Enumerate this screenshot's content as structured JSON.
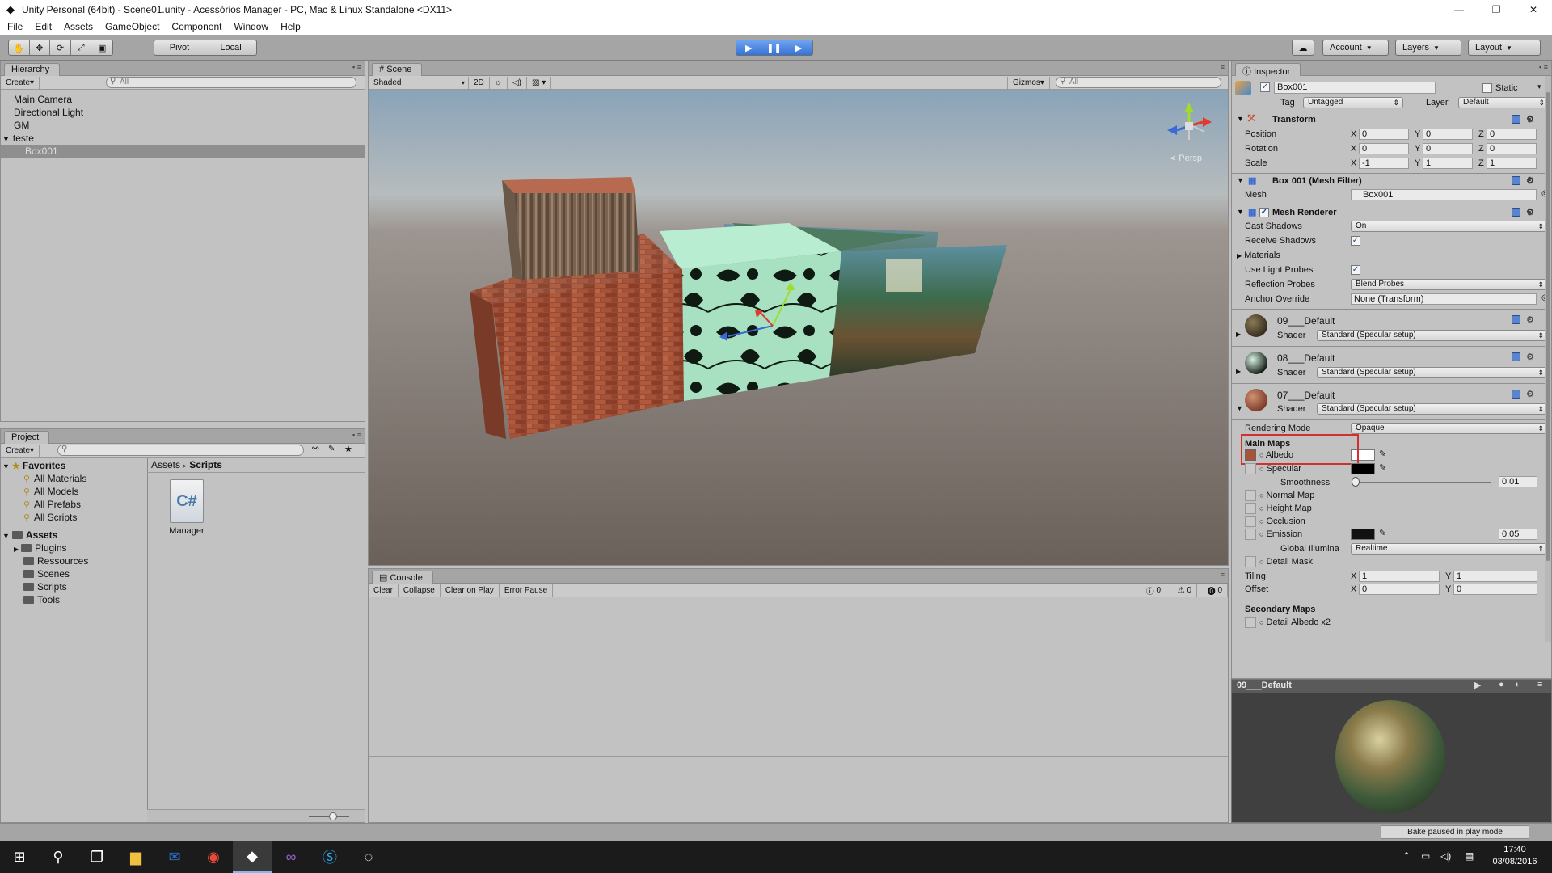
{
  "window": {
    "title": "Unity Personal (64bit) - Scene01.unity - Acessórios Manager - PC, Mac & Linux Standalone <DX11>",
    "min": "—",
    "max": "❐",
    "close": "✕"
  },
  "menu": [
    "File",
    "Edit",
    "Assets",
    "GameObject",
    "Component",
    "Window",
    "Help"
  ],
  "toolbar": {
    "pivot": "Pivot",
    "local": "Local",
    "account": "Account",
    "layers": "Layers",
    "layout": "Layout"
  },
  "hierarchy": {
    "tab": "Hierarchy",
    "create": "Create",
    "search_placeholder": "All",
    "items": [
      "Main Camera",
      "Directional Light",
      "GM",
      "teste",
      "Box001"
    ]
  },
  "scene": {
    "tab": "Scene",
    "shading": "Shaded",
    "mode2d": "2D",
    "gizmos": "Gizmos",
    "search_placeholder": "All",
    "persp": "Persp"
  },
  "project": {
    "tab": "Project",
    "create": "Create",
    "favorites_label": "Favorites",
    "favorites": [
      "All Materials",
      "All Models",
      "All Prefabs",
      "All Scripts"
    ],
    "assets_label": "Assets",
    "assets": [
      "Plugins",
      "Ressources",
      "Scenes",
      "Scripts",
      "Tools"
    ],
    "breadcrumb": [
      "Assets",
      "Scripts"
    ],
    "breadcrumb_sep": "▸",
    "files": [
      {
        "name": "Manager",
        "icon": "C#"
      }
    ]
  },
  "console": {
    "tab": "Console",
    "buttons": [
      "Clear",
      "Collapse",
      "Clear on Play",
      "Error Pause"
    ],
    "counts": {
      "info": "0",
      "warn": "0",
      "error": "0"
    }
  },
  "inspector": {
    "tab": "Inspector",
    "object_name": "Box001",
    "static_label": "Static",
    "tag_label": "Tag",
    "tag": "Untagged",
    "layer_label": "Layer",
    "layer": "Default",
    "transform": {
      "title": "Transform",
      "rows": [
        {
          "label": "Position",
          "x": "0",
          "y": "0",
          "z": "0"
        },
        {
          "label": "Rotation",
          "x": "0",
          "y": "0",
          "z": "0"
        },
        {
          "label": "Scale",
          "x": "-1",
          "y": "1",
          "z": "1"
        }
      ]
    },
    "axis": {
      "x": "X",
      "y": "Y",
      "z": "Z"
    },
    "mesh_filter": {
      "title": "Box 001 (Mesh Filter)",
      "mesh_label": "Mesh",
      "mesh": "Box001"
    },
    "mesh_renderer": {
      "title": "Mesh Renderer",
      "cast_shadows_label": "Cast Shadows",
      "cast_shadows": "On",
      "receive_shadows_label": "Receive Shadows",
      "materials_label": "Materials",
      "light_probes_label": "Use Light Probes",
      "reflection_probes_label": "Reflection Probes",
      "reflection_probes": "Blend Probes",
      "anchor_label": "Anchor Override",
      "anchor": "None (Transform)"
    },
    "materials": [
      {
        "name": "09___Default",
        "shader_label": "Shader",
        "shader": "Standard (Specular setup)"
      },
      {
        "name": "08___Default",
        "shader_label": "Shader",
        "shader": "Standard (Specular setup)"
      },
      {
        "name": "07___Default",
        "shader_label": "Shader",
        "shader": "Standard (Specular setup)"
      }
    ],
    "rendering_mode_label": "Rendering Mode",
    "rendering_mode": "Opaque",
    "main_maps": "Main Maps",
    "albedo": "Albedo",
    "specular": "Specular",
    "smoothness_label": "Smoothness",
    "smoothness": "0.01",
    "smoothness_fraction": 0.01,
    "normal_map": "Normal Map",
    "height_map": "Height Map",
    "occlusion": "Occlusion",
    "emission": "Emission",
    "emission_value": "0.05",
    "gi_label": "Global Illumina",
    "gi": "Realtime",
    "detail_mask": "Detail Mask",
    "tiling_label": "Tiling",
    "tiling_x": "1",
    "tiling_y": "1",
    "offset_label": "Offset",
    "offset_x": "0",
    "offset_y": "0",
    "secondary_maps": "Secondary Maps",
    "detail_albedo": "Detail Albedo x2",
    "preview_title": "09___Default"
  },
  "status": {
    "bake": "Bake paused in play mode"
  },
  "taskbar": {
    "time": "17:40",
    "date": "03/08/2016"
  },
  "colors": {
    "play_active": "#3b79e0",
    "highlight_red": "#d03030"
  }
}
